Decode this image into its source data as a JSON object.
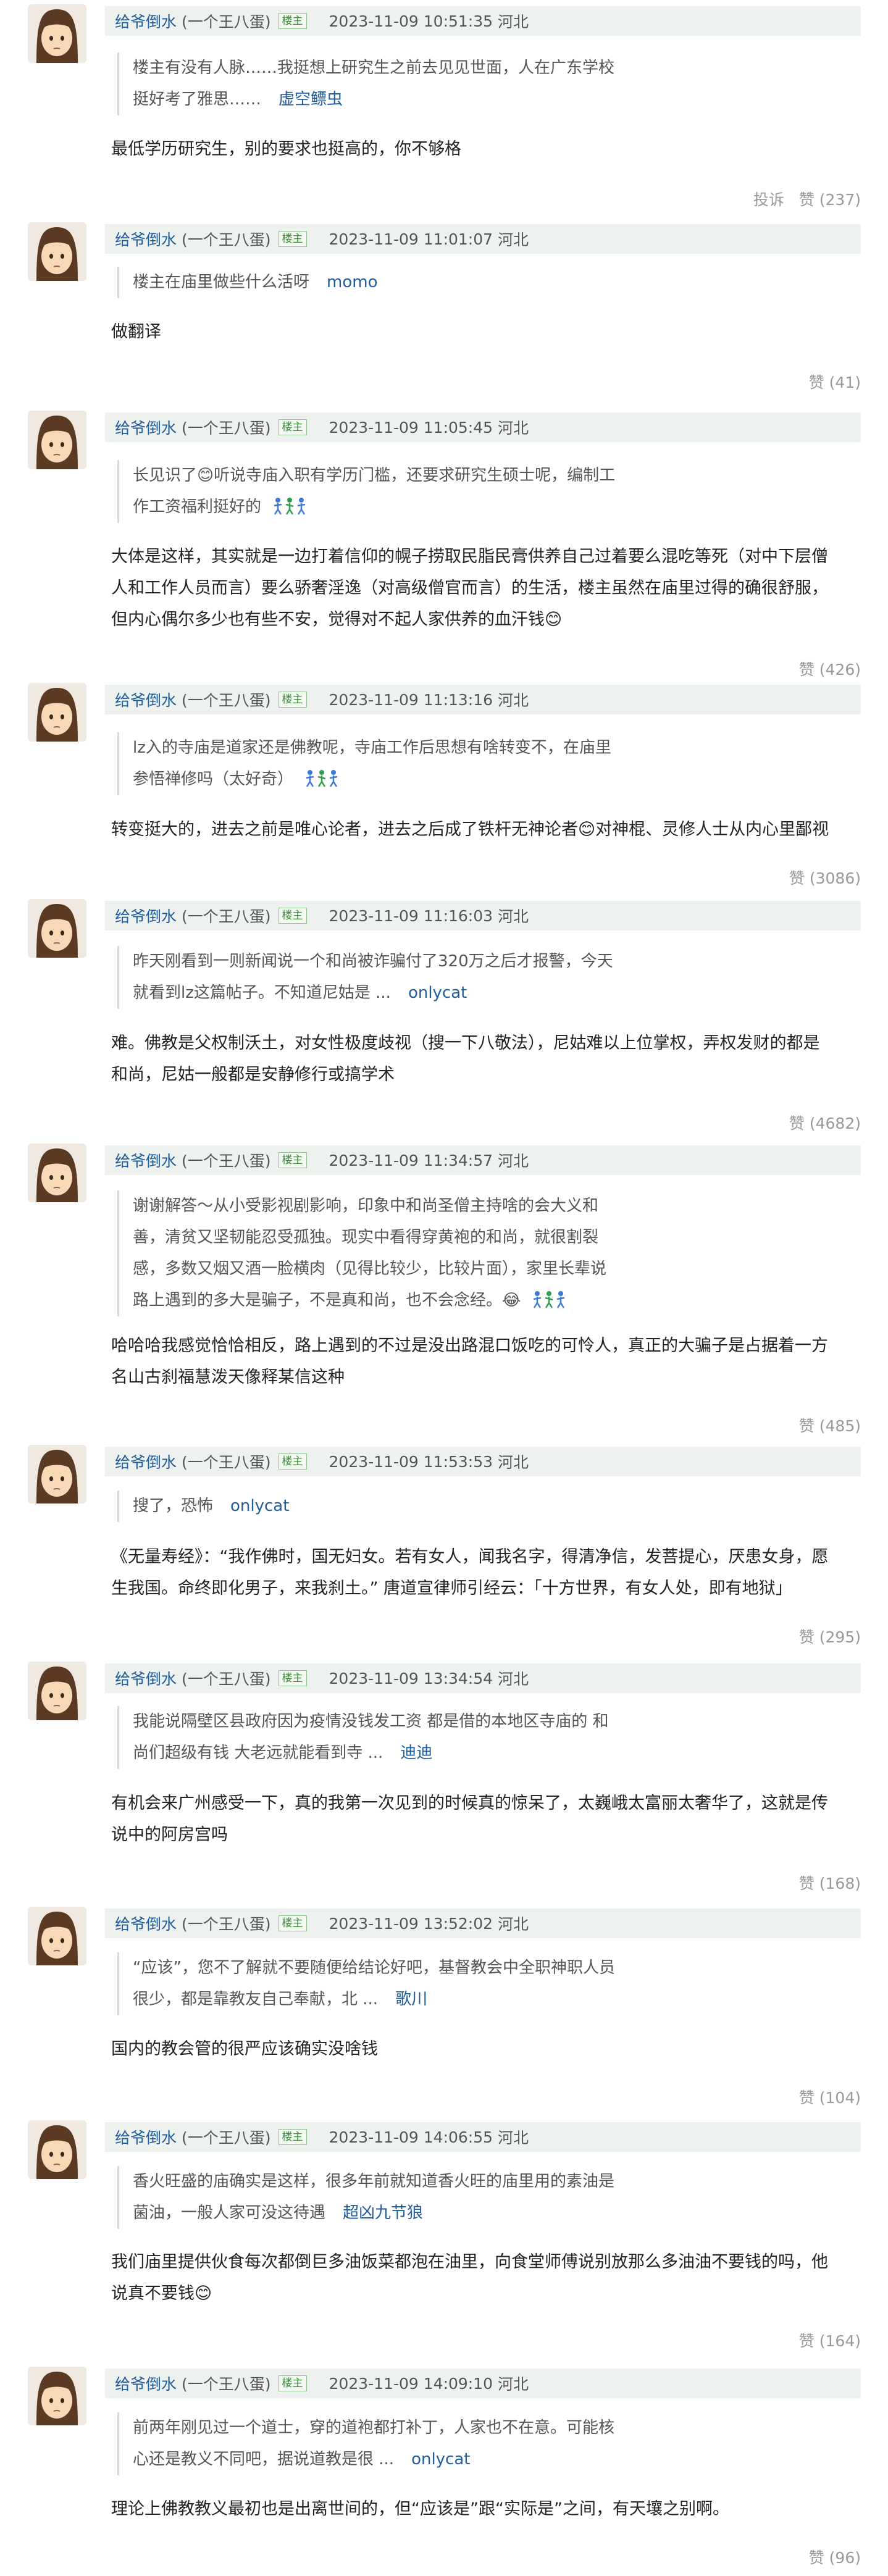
{
  "thread": {
    "replies": [
      {
        "user": "给爷倒水",
        "alias": "(一个王八蛋)",
        "badge": "楼主",
        "time": "2023-11-09 10:51:35",
        "location": "河北",
        "quote_text": "楼主有没有人脉……我挺想上研究生之前去见见世面，人在广东学校\n挺好考了雅思……",
        "quote_author": "虚空鳔虫",
        "content": "最低学历研究生，别的要求也挺高的，你不够格",
        "report_label": "投诉",
        "like_label": "赞 (237)"
      },
      {
        "user": "给爷倒水",
        "alias": "(一个王八蛋)",
        "badge": "楼主",
        "time": "2023-11-09 11:01:07",
        "location": "河北",
        "quote_text": "楼主在庙里做些什么活呀",
        "quote_author": "momo",
        "content": "做翻译",
        "like_label": "赞 (41)"
      },
      {
        "user": "给爷倒水",
        "alias": "(一个王八蛋)",
        "badge": "楼主",
        "time": "2023-11-09 11:05:45",
        "location": "河北",
        "quote_text": "长见识了😊听说寺庙入职有学历门槛，还要求研究生硕士呢，编制工\n作工资福利挺好的",
        "quote_author": "",
        "content": "大体是这样，其实就是一边打着信仰的幌子捞取民脂民膏供养自己过着要么混吃等死（对中下层僧\n人和工作人员而言）要么骄奢淫逸（对高级僧官而言）的生活，楼主虽然在庙里过得的确很舒服，\n但内心偶尔多少也有些不安，觉得对不起人家供养的血汗钱😊",
        "like_label": "赞 (426)"
      },
      {
        "user": "给爷倒水",
        "alias": "(一个王八蛋)",
        "badge": "楼主",
        "time": "2023-11-09 11:13:16",
        "location": "河北",
        "quote_text": "lz入的寺庙是道家还是佛教呢，寺庙工作后思想有啥转变不，在庙里\n参悟禅修吗（太好奇）",
        "quote_author": "",
        "content": "转变挺大的，进去之前是唯心论者，进去之后成了铁杆无神论者😊对神棍、灵修人士从内心里鄙视",
        "like_label": "赞 (3086)"
      },
      {
        "user": "给爷倒水",
        "alias": "(一个王八蛋)",
        "badge": "楼主",
        "time": "2023-11-09 11:16:03",
        "location": "河北",
        "quote_text": "昨天刚看到一则新闻说一个和尚被诈骗付了320万之后才报警，今天\n就看到lz这篇帖子。不知道尼姑是 ...",
        "quote_author": "onlycat",
        "content": "难。佛教是父权制沃土，对女性极度歧视（搜一下八敬法），尼姑难以上位掌权，弄权发财的都是\n和尚，尼姑一般都是安静修行或搞学术",
        "like_label": "赞 (4682)"
      },
      {
        "user": "给爷倒水",
        "alias": "(一个王八蛋)",
        "badge": "楼主",
        "time": "2023-11-09 11:34:57",
        "location": "河北",
        "quote_text": "谢谢解答～从小受影视剧影响，印象中和尚圣僧主持啥的会大义和\n善，清贫又坚韧能忍受孤独。现实中看得穿黄袍的和尚，就很割裂\n感，多数又烟又酒一脸横肉（见得比较少，比较片面），家里长辈说\n路上遇到的多大是骗子，不是真和尚，也不会念经。😂",
        "quote_author": "",
        "content": "哈哈哈我感觉恰恰相反，路上遇到的不过是没出路混口饭吃的可怜人，真正的大骗子是占据着一方\n名山古刹福慧泼天像释某信这种",
        "like_label": "赞 (485)"
      },
      {
        "user": "给爷倒水",
        "alias": "(一个王八蛋)",
        "badge": "楼主",
        "time": "2023-11-09 11:53:53",
        "location": "河北",
        "quote_text": "搜了，恐怖",
        "quote_author": "onlycat",
        "content": "《无量寿经》：“我作佛时，国无妇女。若有女人，闻我名字，得清净信，发菩提心，厌患女身，愿\n生我国。命终即化男子，来我刹土。” 唐道宣律师引经云：「十方世界，有女人处，即有地狱」",
        "like_label": "赞 (295)"
      },
      {
        "user": "给爷倒水",
        "alias": "(一个王八蛋)",
        "badge": "楼主",
        "time": "2023-11-09 13:34:54",
        "location": "河北",
        "quote_text": "我能说隔壁区县政府因为疫情没钱发工资 都是借的本地区寺庙的 和\n尚们超级有钱 大老远就能看到寺 ...",
        "quote_author": "迪迪",
        "content": "有机会来广州感受一下，真的我第一次见到的时候真的惊呆了，太巍峨太富丽太奢华了，这就是传\n说中的阿房宫吗",
        "like_label": "赞 (168)"
      },
      {
        "user": "给爷倒水",
        "alias": "(一个王八蛋)",
        "badge": "楼主",
        "time": "2023-11-09 13:52:02",
        "location": "河北",
        "quote_text": "“应该”，您不了解就不要随便给结论好吧，基督教会中全职神职人员\n很少，都是靠教友自己奉献，北 ...",
        "quote_author": "歌川",
        "content": "国内的教会管的很严应该确实没啥钱",
        "like_label": "赞 (104)"
      },
      {
        "user": "给爷倒水",
        "alias": "(一个王八蛋)",
        "badge": "楼主",
        "time": "2023-11-09 14:06:55",
        "location": "河北",
        "quote_text": "香火旺盛的庙确实是这样，很多年前就知道香火旺的庙里用的素油是\n菌油，一般人家可没这待遇",
        "quote_author": "超凶九节狼",
        "content": "我们庙里提供伙食每次都倒巨多油饭菜都泡在油里，向食堂师傅说别放那么多油油不要钱的吗，他\n说真不要钱😊",
        "like_label": "赞 (164)"
      },
      {
        "user": "给爷倒水",
        "alias": "(一个王八蛋)",
        "badge": "楼主",
        "time": "2023-11-09 14:09:10",
        "location": "河北",
        "quote_text": "前两年刚见过一个道士，穿的道袍都打补丁，人家也不在意。可能核\n心还是教义不同吧，据说道教是很 ...",
        "quote_author": "onlycat",
        "content": "理论上佛教教义最初也是出离世间的，但“应该是”跟“实际是”之间，有天壤之别啊。",
        "like_label": "赞 (96)"
      }
    ]
  }
}
